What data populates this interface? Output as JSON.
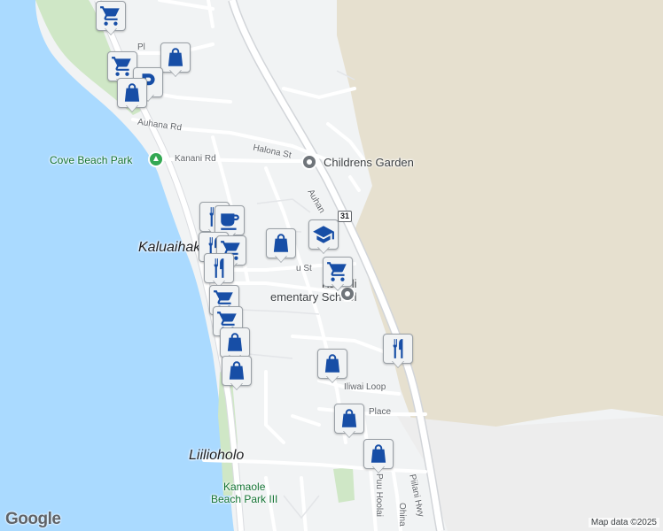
{
  "map": {
    "colors": {
      "water": "#aadaff",
      "land": "#f1f3f4",
      "terrain": "#e8e2d1",
      "park": "#c8e6c9",
      "road": "#ffffff",
      "highway": "#dadce0",
      "marker_icon": "#174ea6"
    },
    "labels": {
      "place_kaluaihakoko": "Kaluaihak",
      "place_liilioholo": "Liilioholo",
      "park_cove": "Cove Beach Park",
      "park_kamaole": "Kamaole\nBeach Park III",
      "poi_childrens_garden": "Childrens Garden",
      "poi_school": "Kamali\nementary School",
      "street_auhana_rd": "Auhana Rd",
      "street_halona_st": "Halona St",
      "street_kanani_rd": "Kanani Rd",
      "street_auhana": "Auhan",
      "street_u_st": "u St",
      "street_iliwai_loop": "Iliwai Loop",
      "street_place": "Place",
      "street_piilani_hwy": "Piilani Hwy",
      "street_puu_hoolai": "Puu Hoolai",
      "street_ohina": "Ohina",
      "street_pl": "Pl",
      "route_31": "31"
    },
    "markers": [
      {
        "type": "shopping-cart",
        "label": "shopping-cart-icon"
      },
      {
        "type": "shopping-bag",
        "label": "shopping-bag-icon"
      },
      {
        "type": "shopping-cart",
        "label": "shopping-cart-icon"
      },
      {
        "type": "parking",
        "label": "parking-icon"
      },
      {
        "type": "shopping-bag",
        "label": "shopping-bag-icon"
      },
      {
        "type": "restaurant",
        "label": "restaurant-icon"
      },
      {
        "type": "cafe",
        "label": "cafe-icon"
      },
      {
        "type": "restaurant",
        "label": "restaurant-icon"
      },
      {
        "type": "shopping-cart",
        "label": "shopping-cart-icon"
      },
      {
        "type": "restaurant",
        "label": "restaurant-icon"
      },
      {
        "type": "shopping-bag",
        "label": "shopping-bag-icon"
      },
      {
        "type": "school",
        "label": "school-icon"
      },
      {
        "type": "shopping-cart",
        "label": "shopping-cart-icon"
      },
      {
        "type": "shopping-cart",
        "label": "shopping-cart-icon"
      },
      {
        "type": "shopping-cart",
        "label": "shopping-cart-icon"
      },
      {
        "type": "shopping-bag",
        "label": "shopping-bag-icon"
      },
      {
        "type": "restaurant",
        "label": "restaurant-icon"
      },
      {
        "type": "shopping-bag",
        "label": "shopping-bag-icon"
      },
      {
        "type": "shopping-bag",
        "label": "shopping-bag-icon"
      },
      {
        "type": "shopping-bag",
        "label": "shopping-bag-icon"
      },
      {
        "type": "shopping-bag",
        "label": "shopping-bag-icon"
      }
    ],
    "logo": "Google",
    "attribution": "Map data ©2025"
  }
}
